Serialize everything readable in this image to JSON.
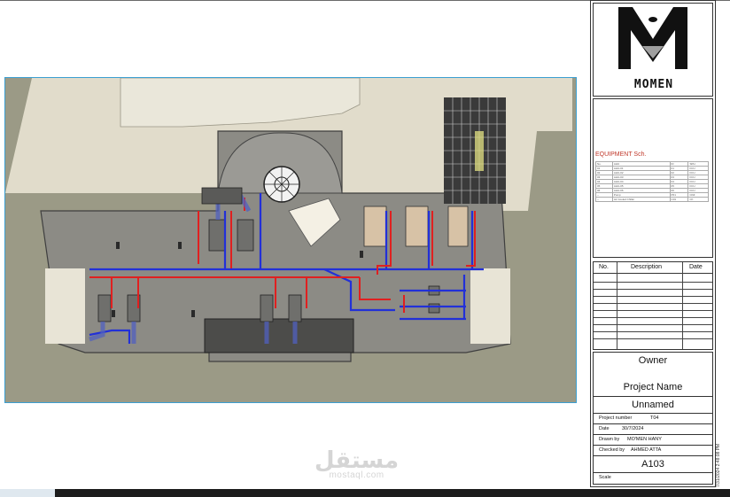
{
  "title_block": {
    "logo_text": "MOMEN",
    "equipment_schedule_title": "EQUIPMENT Sch.",
    "equipment_rows": [
      [
        "No.",
        "AHU",
        "ID",
        "SPH"
      ],
      [
        "01",
        "AHU-01",
        "01",
        "FCU"
      ],
      [
        "02",
        "AHU-02",
        "02",
        "FCU"
      ],
      [
        "03",
        "AHU-03",
        "03",
        "FCU"
      ],
      [
        "04",
        "AHU-04",
        "04",
        "FCU"
      ],
      [
        "05",
        "AHU-05",
        "05",
        "FCU"
      ],
      [
        "06",
        "AHU-06",
        "06",
        "FCU"
      ],
      [
        "--",
        "Pump",
        "P01",
        "Chill"
      ],
      [
        "--",
        "Air Cooled Chiller",
        "C01",
        "Ch"
      ]
    ],
    "revision_headers": {
      "no": "No.",
      "description": "Description",
      "date": "Date"
    },
    "owner": "Owner",
    "project_name": "Project Name",
    "unnamed": "Unnamed",
    "project_number_label": "Project number",
    "project_number_value": "T04",
    "date_label": "Date",
    "date_value": "30/7/2024",
    "drawn_by_label": "Drawn by",
    "drawn_by_value": "MO'MEN HANY",
    "checked_by_label": "Checked by",
    "checked_by_value": "AHMED ATTA",
    "sheet_number": "A103",
    "scale_label": "Scale"
  },
  "side_stamp": "7/31/2024 2:48:08 PM",
  "watermark": {
    "arabic": "مستقل",
    "latin": "mostaql.com"
  },
  "colors": {
    "supply_pipe": "#e02020",
    "return_pipe": "#2230d8",
    "floor": "#8c8c86",
    "background_ground": "#9b9a86",
    "building_light": "#e3dfcf"
  }
}
